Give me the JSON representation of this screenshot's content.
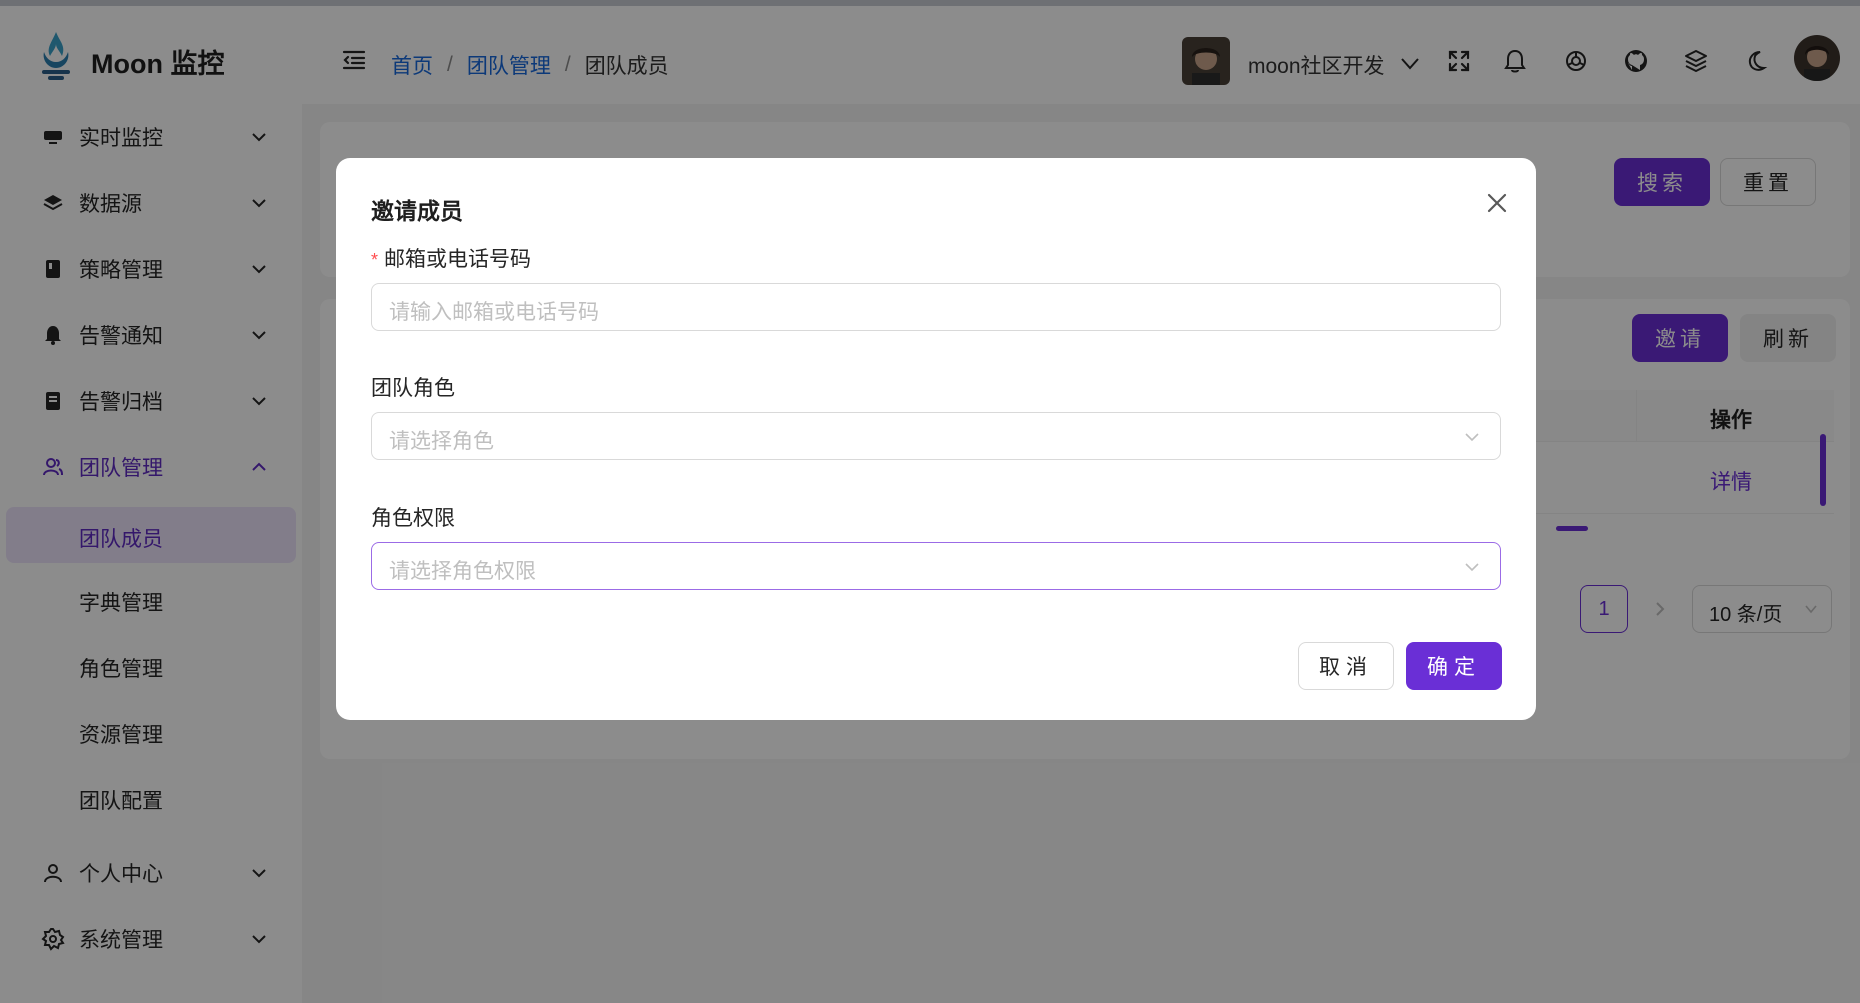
{
  "app": {
    "name": "Moon 监控"
  },
  "breadcrumb": {
    "home": "首页",
    "section": "团队管理",
    "current": "团队成员",
    "separator": "/"
  },
  "header": {
    "team_name": "moon社区开发"
  },
  "sidebar": {
    "items": [
      {
        "label": "实时监控",
        "icon": "monitor-icon"
      },
      {
        "label": "数据源",
        "icon": "layers-icon"
      },
      {
        "label": "策略管理",
        "icon": "book-icon"
      },
      {
        "label": "告警通知",
        "icon": "bell-icon"
      },
      {
        "label": "告警归档",
        "icon": "archive-icon"
      },
      {
        "label": "团队管理",
        "icon": "team-icon"
      }
    ],
    "sub_items": [
      {
        "label": "团队成员"
      },
      {
        "label": "字典管理"
      },
      {
        "label": "角色管理"
      },
      {
        "label": "资源管理"
      },
      {
        "label": "团队配置"
      }
    ],
    "bottom_items": [
      {
        "label": "个人中心",
        "icon": "user-icon"
      },
      {
        "label": "系统管理",
        "icon": "settings-icon"
      }
    ]
  },
  "search_card": {
    "search_label": "搜索",
    "reset_label": "重置"
  },
  "table_card": {
    "invite_label": "邀请",
    "refresh_label": "刷新",
    "column_action": "操作",
    "row_action": "详情",
    "page": "1",
    "page_size": "10 条/页"
  },
  "modal": {
    "title": "邀请成员",
    "contact_label": "邮箱或电话号码",
    "contact_required_mark": "*",
    "contact_placeholder": "请输入邮箱或电话号码",
    "role_label": "团队角色",
    "role_placeholder": "请选择角色",
    "permission_label": "角色权限",
    "permission_placeholder": "请选择角色权限",
    "cancel_label": "取消",
    "ok_label": "确定"
  },
  "colors": {
    "primary": "#6a2fd6",
    "link": "#1668dc",
    "active_bg": "#ede4fb",
    "required": "#ff4d4f"
  }
}
